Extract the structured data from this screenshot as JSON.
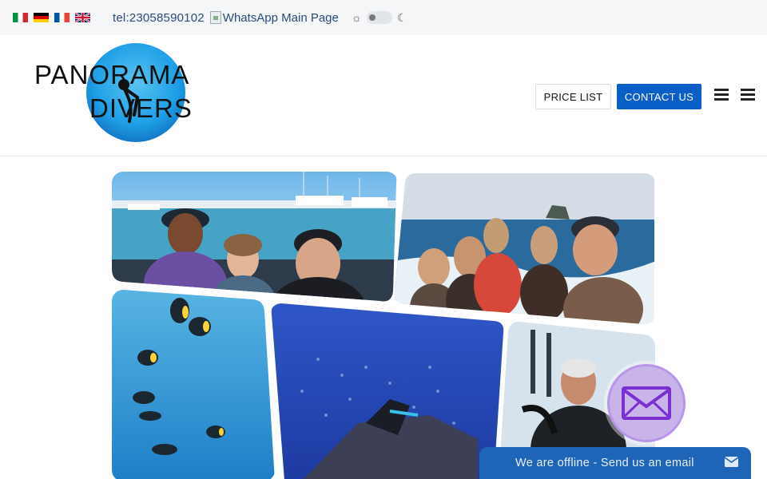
{
  "topbar": {
    "languages": [
      {
        "code": "it",
        "icon": "italy-flag-icon"
      },
      {
        "code": "de",
        "icon": "germany-flag-icon"
      },
      {
        "code": "fr",
        "icon": "france-flag-icon"
      },
      {
        "code": "en",
        "icon": "uk-flag-icon"
      }
    ],
    "phone": "tel:23058590102",
    "whatsapp_alt": "WhatsApp Main Page",
    "theme_toggle": {
      "light_icon": "sun-icon",
      "dark_icon": "moon-icon",
      "state": "light"
    }
  },
  "header": {
    "logo": {
      "line1": "PANORAMA",
      "line2": "DIVERS",
      "circle_color": "#1e9fe6"
    },
    "price_list_label": "PRICE LIST",
    "contact_label": "CONTACT US",
    "accent_color": "#0a5ec8"
  },
  "collage": {
    "photos": [
      {
        "name": "group-selfie-marina"
      },
      {
        "name": "boat-group-ocean"
      },
      {
        "name": "reef-fish"
      },
      {
        "name": "divers-shipwreck"
      },
      {
        "name": "diver-on-boat"
      }
    ]
  },
  "chat": {
    "mail_icon": "envelope-icon",
    "offline_text": "We are offline - Send us an email",
    "bar_color": "#1e65b8"
  }
}
